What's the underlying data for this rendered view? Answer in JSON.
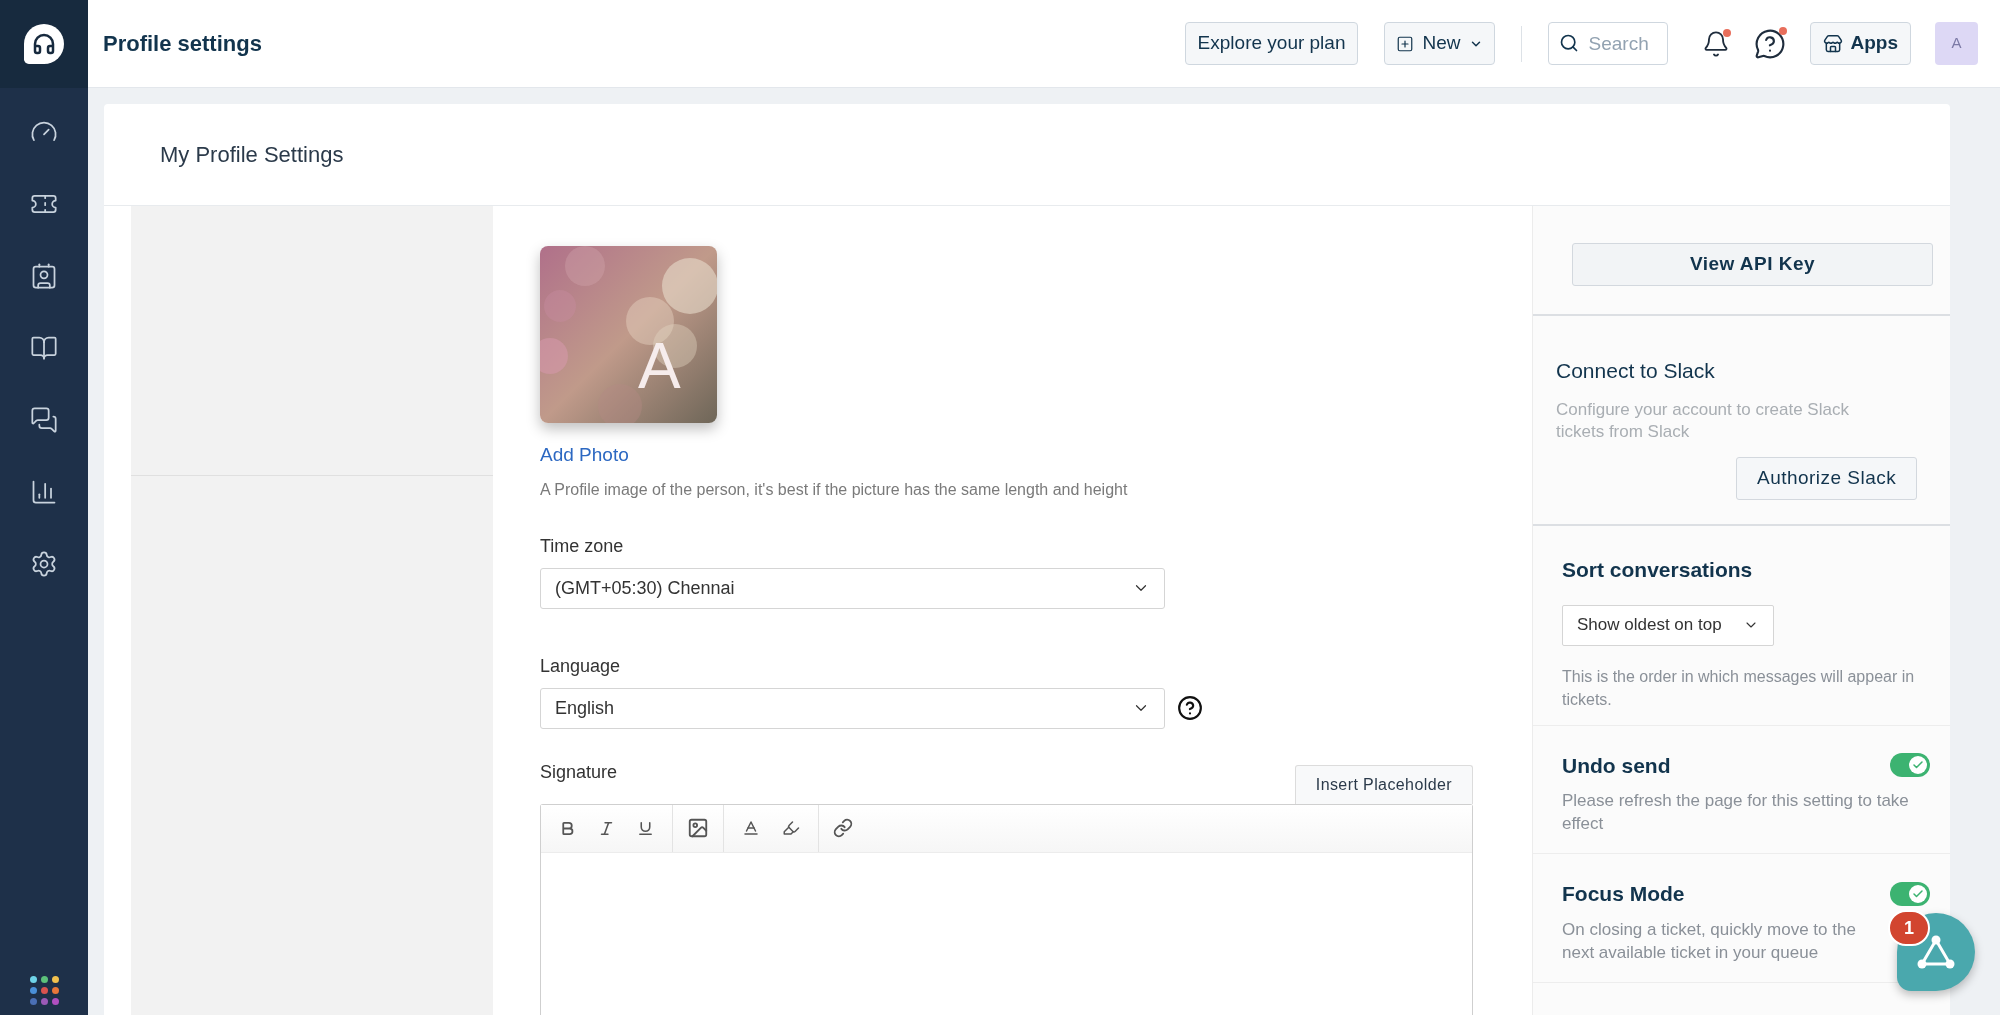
{
  "header": {
    "title": "Profile settings",
    "explore_button": "Explore your plan",
    "new_button": "New",
    "search": {
      "placeholder": "Search"
    },
    "bell": {
      "badge_dot": true
    },
    "help": {
      "badge_dot": true
    },
    "apps_button": "Apps",
    "avatar": "A"
  },
  "page": {
    "title": "My Profile Settings"
  },
  "profile": {
    "photo": {
      "kind": "picture",
      "initial": "A"
    },
    "add_photo": "Add Photo",
    "photo_hint": "A Profile image of the person, it's best if the picture has the same length and height"
  },
  "time_zone": {
    "label": "Time zone",
    "value": "(GMT+05:30) Chennai"
  },
  "language": {
    "label": "Language",
    "value": "English"
  },
  "signature": {
    "label": "Signature",
    "insert_button": "Insert Placeholder"
  },
  "side_panel": {
    "api_button": "View API Key",
    "slack": {
      "title": "Connect to Slack",
      "description": "Configure your account to create Slack tickets from Slack",
      "button": "Authorize Slack"
    },
    "sort": {
      "title": "Sort conversations",
      "value": "Show oldest on top",
      "description": "This is the order in which messages will appear in tickets."
    },
    "toggles": [
      {
        "title": "Undo send",
        "description": "Please refresh the page for this setting to take effect",
        "on": true
      },
      {
        "title": "Focus Mode",
        "description": "On closing a ticket, quickly move to the next available ticket in your queue",
        "on": true
      }
    ]
  },
  "chat_widget": {
    "badge": "1"
  }
}
